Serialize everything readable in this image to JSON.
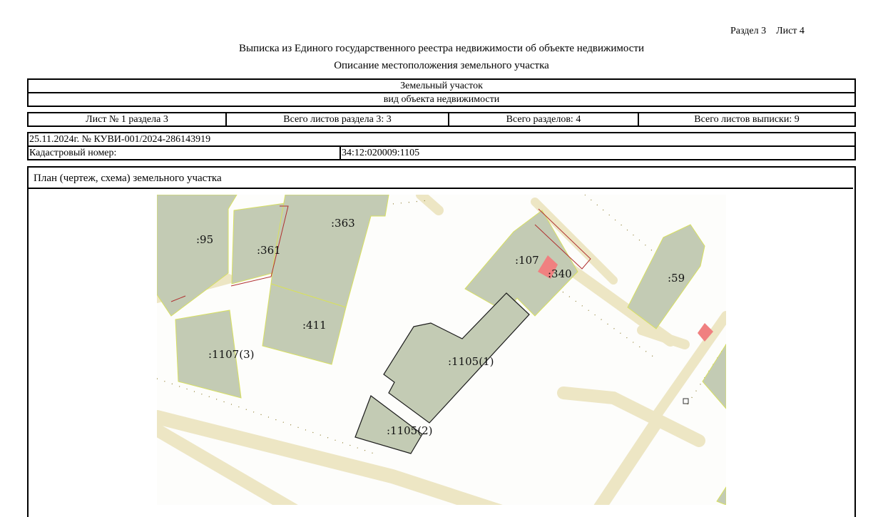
{
  "header": {
    "section_label": "Раздел 3",
    "sheet_label": "Лист 4",
    "title": "Выписка из Единого государственного реестра недвижимости об объекте недвижимости",
    "subtitle": "Описание местоположения земельного участка"
  },
  "object": {
    "kind_value": "Земельный участок",
    "kind_caption": "вид объекта недвижимости"
  },
  "sheets": {
    "sheet_no": "Лист № 1 раздела 3",
    "total_in_section": "Всего листов раздела 3: 3",
    "total_sections": "Всего разделов: 4",
    "total_sheets": "Всего листов выписки: 9"
  },
  "record": {
    "date_number": "25.11.2024г. № КУВИ-001/2024-286143919",
    "cadastral_label": "Кадастровый номер:",
    "cadastral_value": "34:12:020009:1105"
  },
  "plan": {
    "title": "План (чертеж, схема) земельного участка",
    "labels": {
      "p95": ":95",
      "p361": ":361",
      "p363": ":363",
      "p411": ":411",
      "p1107": ":1107(3)",
      "p107": ":107",
      "p340": ":340",
      "p59": ":59",
      "p1105_1": ":1105(1)",
      "p1105_2": ":1105(2)"
    },
    "colors": {
      "parcel_fill": "#c3cbb4",
      "road": "#ede6c4",
      "building": "#f08080"
    }
  }
}
